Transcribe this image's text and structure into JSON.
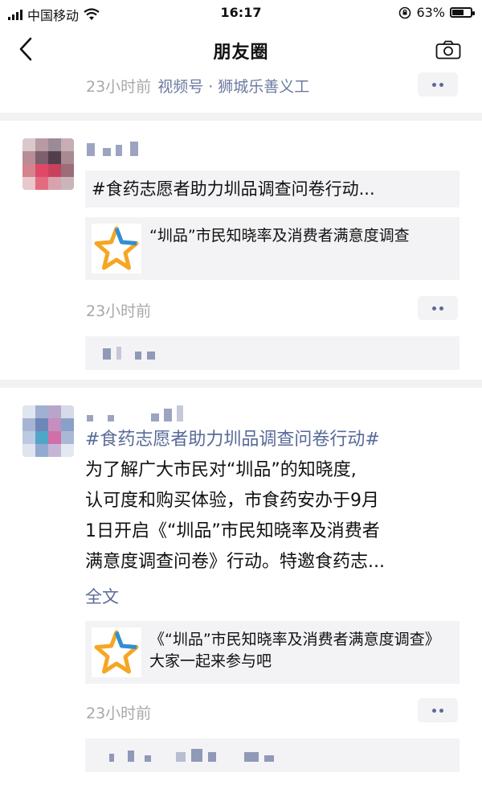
{
  "status_bar": {
    "carrier": "中国移动",
    "time": "16:17",
    "battery_text": "63%",
    "battery_level": 0.63
  },
  "nav": {
    "title": "朋友圈",
    "back_icon": "chevron-left-icon",
    "camera_icon": "camera-icon"
  },
  "posts": [
    {
      "time": "23小时前",
      "source": "视频号 · 狮城乐善义工"
    },
    {
      "topic": "#食药志愿者助力圳品调查问卷行动...",
      "card_text": "“圳品”市民知晓率及消费者满意度调查",
      "time": "23小时前"
    },
    {
      "hashtag": "#食药志愿者助力圳品调查问卷行动#",
      "body_lines": [
        "为了解广大市民对“圳品”的知晓度,",
        "认可度和购买体验，市食药安办于9月",
        "1日开启《“圳品”市民知晓率及消费者",
        "满意度调查问卷》行动。特邀食药志..."
      ],
      "full_text_label": "全文",
      "card_text": "《“圳品”市民知晓率及消费者满意度调查》大家一起来参与吧",
      "time": "23小时前"
    }
  ],
  "colors": {
    "link": "#596a98",
    "time_gray": "#a8a8a8",
    "box_bg": "#f3f3f5",
    "star_orange": "#f5a623",
    "star_blue": "#2f8fd8"
  }
}
